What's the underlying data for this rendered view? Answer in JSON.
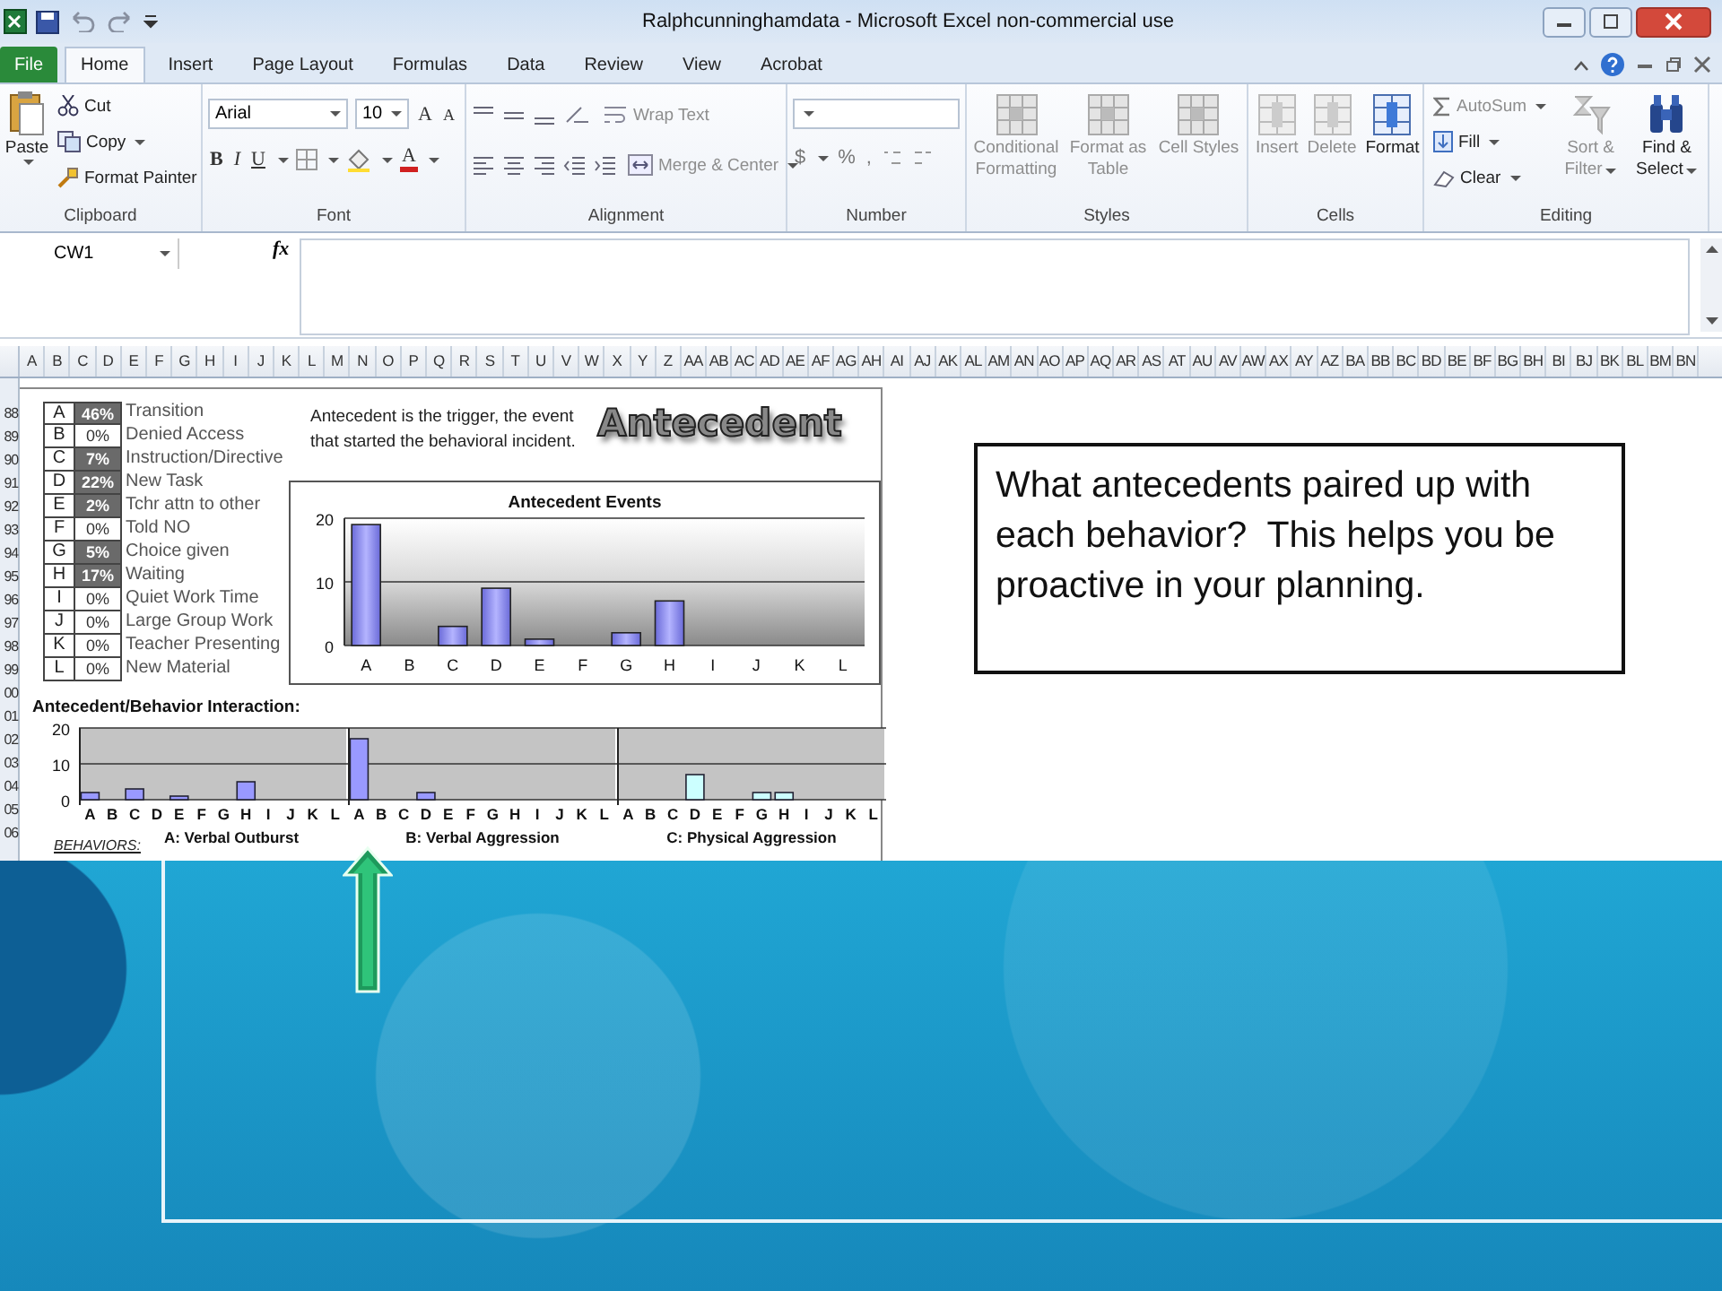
{
  "window": {
    "title": "Ralphcunninghamdata - Microsoft Excel non-commercial use"
  },
  "tabs": [
    {
      "label": "File",
      "selected": false,
      "kind": "file"
    },
    {
      "label": "Home",
      "selected": true,
      "kind": "tab"
    },
    {
      "label": "Insert",
      "selected": false,
      "kind": "tab"
    },
    {
      "label": "Page Layout",
      "selected": false,
      "kind": "tab"
    },
    {
      "label": "Formulas",
      "selected": false,
      "kind": "tab"
    },
    {
      "label": "Data",
      "selected": false,
      "kind": "tab"
    },
    {
      "label": "Review",
      "selected": false,
      "kind": "tab"
    },
    {
      "label": "View",
      "selected": false,
      "kind": "tab"
    },
    {
      "label": "Acrobat",
      "selected": false,
      "kind": "tab"
    }
  ],
  "ribbon": {
    "clipboard": {
      "label": "Clipboard",
      "paste": "Paste",
      "cut": "Cut",
      "copy": "Copy",
      "format_painter": "Format Painter"
    },
    "font": {
      "label": "Font",
      "family": "Arial",
      "size": "10",
      "grow": "A",
      "shrink": "A",
      "bold": "B",
      "italic": "I",
      "underline": "U",
      "font_color": "A"
    },
    "alignment": {
      "label": "Alignment",
      "wrap_text": {
        "label": "Wrap Text",
        "disabled": true
      },
      "merge": {
        "label": "Merge & Center",
        "disabled": true
      }
    },
    "number": {
      "label": "Number",
      "currency": "$",
      "percent": "%",
      "comma": ","
    },
    "styles": {
      "label": "Styles",
      "buttons": [
        {
          "label": "Conditional Formatting",
          "disabled": true
        },
        {
          "label": "Format as Table",
          "disabled": true
        },
        {
          "label": "Cell Styles",
          "disabled": true
        }
      ]
    },
    "cells": {
      "label": "Cells",
      "buttons": [
        {
          "label": "Insert",
          "disabled": true
        },
        {
          "label": "Delete",
          "disabled": true
        },
        {
          "label": "Format",
          "disabled": false
        }
      ]
    },
    "editing": {
      "label": "Editing",
      "small": [
        {
          "label": "AutoSum",
          "disabled": true
        },
        {
          "label": "Fill",
          "disabled": false
        },
        {
          "label": "Clear",
          "disabled": false
        }
      ],
      "buttons": [
        {
          "label": "Sort & Filter",
          "disabled": true
        },
        {
          "label": "Find & Select",
          "disabled": false
        }
      ]
    }
  },
  "formula_bar": {
    "name_box": "CW1",
    "fx": "fx"
  },
  "columns": [
    "A",
    "B",
    "C",
    "D",
    "E",
    "F",
    "G",
    "H",
    "I",
    "J",
    "K",
    "L",
    "M",
    "N",
    "O",
    "P",
    "Q",
    "R",
    "S",
    "T",
    "U",
    "V",
    "W",
    "X",
    "Y",
    "Z",
    "AA",
    "AB",
    "AC",
    "AD",
    "AE",
    "AF",
    "AG",
    "AH",
    "AI",
    "AJ",
    "AK",
    "AL",
    "AM",
    "AN",
    "AO",
    "AP",
    "AQ",
    "AR",
    "AS",
    "AT",
    "AU",
    "AV",
    "AW",
    "AX",
    "AY",
    "AZ",
    "BA",
    "BB",
    "BC",
    "BD",
    "BE",
    "BF",
    "BG",
    "BH",
    "BI",
    "BJ",
    "BK",
    "BL",
    "BM",
    "BN"
  ],
  "rows": [
    "88",
    "89",
    "90",
    "91",
    "92",
    "93",
    "94",
    "95",
    "96",
    "97",
    "98",
    "99",
    "00",
    "01",
    "02",
    "03",
    "04",
    "05",
    "06"
  ],
  "sheet": {
    "legend": [
      {
        "letter": "A",
        "percent": "46%",
        "label": "Transition",
        "highlighted": true
      },
      {
        "letter": "B",
        "percent": "0%",
        "label": "Denied Access",
        "highlighted": false
      },
      {
        "letter": "C",
        "percent": "7%",
        "label": "Instruction/Directive",
        "highlighted": true
      },
      {
        "letter": "D",
        "percent": "22%",
        "label": "New Task",
        "highlighted": true
      },
      {
        "letter": "E",
        "percent": "2%",
        "label": "Tchr attn to other",
        "highlighted": true
      },
      {
        "letter": "F",
        "percent": "0%",
        "label": "Told NO",
        "highlighted": false
      },
      {
        "letter": "G",
        "percent": "5%",
        "label": "Choice given",
        "highlighted": true
      },
      {
        "letter": "H",
        "percent": "17%",
        "label": "Waiting",
        "highlighted": true
      },
      {
        "letter": "I",
        "percent": "0%",
        "label": "Quiet Work Time",
        "highlighted": false
      },
      {
        "letter": "J",
        "percent": "0%",
        "label": "Large Group Work",
        "highlighted": false
      },
      {
        "letter": "K",
        "percent": "0%",
        "label": "Teacher Presenting",
        "highlighted": false
      },
      {
        "letter": "L",
        "percent": "0%",
        "label": "New Material",
        "highlighted": false
      }
    ],
    "description": "Antecedent is the trigger, the event that started the behavioral incident.",
    "heading": "Antecedent",
    "antecedent_chart": {
      "chart_data": {
        "type": "bar",
        "title": "Antecedent Events",
        "categories": [
          "A",
          "B",
          "C",
          "D",
          "E",
          "F",
          "G",
          "H",
          "I",
          "J",
          "K",
          "L"
        ],
        "values": [
          19,
          0,
          3,
          9,
          1,
          0,
          2,
          7,
          0,
          0,
          0,
          0
        ],
        "ylim": [
          0,
          20
        ],
        "yticks": [
          0,
          10,
          20
        ]
      }
    },
    "interaction": {
      "title": "Antecedent/Behavior Interaction:",
      "behaviors_label": "BEHAVIORS:",
      "panels": [
        {
          "chart_data": {
            "type": "bar",
            "categories": [
              "A",
              "B",
              "C",
              "D",
              "E",
              "F",
              "G",
              "H",
              "I",
              "J",
              "K",
              "L"
            ],
            "series": [
              {
                "name": "A: Verbal Outburst",
                "color": "#9999ff",
                "values": [
                  2,
                  0,
                  3,
                  0,
                  1,
                  0,
                  0,
                  5,
                  0,
                  0,
                  0,
                  0
                ]
              }
            ],
            "ylim": [
              0,
              20
            ],
            "yticks": [
              0,
              10,
              20
            ]
          }
        },
        {
          "chart_data": {
            "type": "bar",
            "categories": [
              "A",
              "B",
              "C",
              "D",
              "E",
              "F",
              "G",
              "H",
              "I",
              "J",
              "K",
              "L"
            ],
            "series": [
              {
                "name": "B: Verbal Aggression",
                "color": "#9999ff",
                "values": [
                  17,
                  0,
                  0,
                  2,
                  0,
                  0,
                  0,
                  0,
                  0,
                  0,
                  0,
                  0
                ]
              }
            ],
            "ylim": [
              0,
              20
            ]
          }
        },
        {
          "chart_data": {
            "type": "bar",
            "categories": [
              "A",
              "B",
              "C",
              "D",
              "E",
              "F",
              "G",
              "H",
              "I",
              "J",
              "K",
              "L"
            ],
            "series": [
              {
                "name": "C: Physical Aggression",
                "color": "#ccffff",
                "values": [
                  0,
                  0,
                  0,
                  7,
                  0,
                  0,
                  2,
                  2,
                  0,
                  0,
                  0,
                  0
                ]
              }
            ],
            "ylim": [
              0,
              20
            ]
          }
        }
      ]
    }
  },
  "callout": {
    "text": "What antecedents paired up with each behavior?  This helps you be proactive in your planning."
  }
}
